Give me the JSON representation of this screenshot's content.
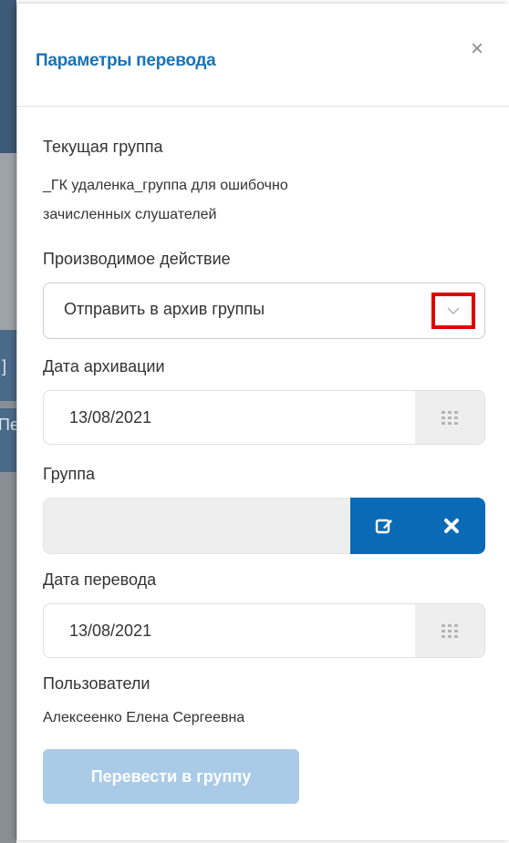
{
  "background": {
    "edge_chars": [
      "]",
      "Пе"
    ]
  },
  "modal": {
    "title": "Параметры перевода",
    "close_label": "×",
    "current_group": {
      "label": "Текущая группа",
      "value_line1": "_ГК удаленка_группа для ошибочно",
      "value_line2": "зачисленных слушателей"
    },
    "action": {
      "label": "Производимое действие",
      "selected": "Отправить в архив группы"
    },
    "archive_date": {
      "label": "Дата архивации",
      "value": "13/08/2021"
    },
    "group": {
      "label": "Группа",
      "value": ""
    },
    "transfer_date": {
      "label": "Дата перевода",
      "value": "13/08/2021"
    },
    "users": {
      "label": "Пользователи",
      "value": "Алексеенко Елена Сергеевна"
    },
    "submit_label": "Перевести в группу"
  },
  "colors": {
    "accent": "#0a6ab6",
    "title": "#1a73b7",
    "disabled_button": "#a9cbe8",
    "highlight": "#e00000"
  },
  "icons": {
    "close": "close-icon",
    "dropdown": "chevron-down-icon",
    "calendar": "calendar-grid-icon",
    "edit": "edit-icon",
    "clear": "x-icon"
  }
}
